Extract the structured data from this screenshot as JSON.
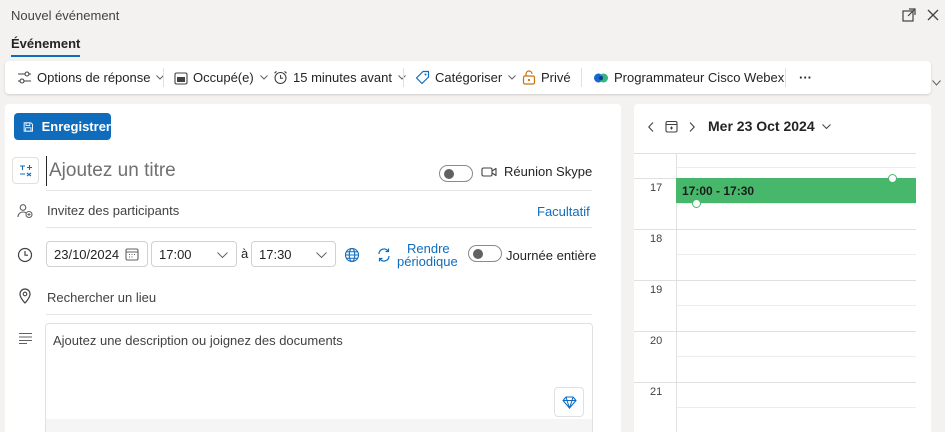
{
  "window": {
    "title": "Nouvel événement"
  },
  "tabs": [
    {
      "label": "Événement"
    }
  ],
  "ribbon": {
    "response_options": "Options de réponse",
    "busy_status": "Occupé(e)",
    "reminder": "15 minutes avant",
    "categorize": "Catégoriser",
    "private": "Privé",
    "webex": "Programmateur Cisco Webex",
    "more": "···"
  },
  "form": {
    "save_label": "Enregistrer",
    "title_placeholder": "Ajoutez un titre",
    "skype_label": "Réunion Skype",
    "skype_on": false,
    "attendees_placeholder": "Invitez des participants",
    "optional_label": "Facultatif",
    "start_date": "23/10/2024",
    "start_time": "17:00",
    "to_label": "à",
    "end_time": "17:30",
    "recurrence_label_line1": "Rendre",
    "recurrence_label_line2": "périodique",
    "all_day_label": "Journée entière",
    "all_day_on": false,
    "location_placeholder": "Rechercher un lieu",
    "description_placeholder": "Ajoutez une description ou joignez des documents"
  },
  "calendar": {
    "date_label": "Mer 23 Oct 2024",
    "hours": [
      "17",
      "18",
      "19",
      "20",
      "21"
    ],
    "event": {
      "label": "17:00 - 17:30",
      "color": "#47b86b"
    }
  },
  "colors": {
    "accent": "#0f6cbd",
    "event": "#47b86b"
  },
  "icons": {
    "popout": "popout-icon",
    "close": "close-icon",
    "response_options": "sliders-icon",
    "busy": "calendar-busy-icon",
    "reminder": "alarm-clock-icon",
    "categorize": "tag-icon",
    "private": "lock-icon",
    "webex": "webex-icon",
    "save": "save-icon",
    "title": "title-icon",
    "attendees": "people-add-icon",
    "time": "clock-icon",
    "timezone": "globe-icon",
    "recurrence": "repeat-icon",
    "location": "location-pin-icon",
    "description": "text-lines-icon",
    "copilot": "gem-icon",
    "video": "video-icon"
  }
}
